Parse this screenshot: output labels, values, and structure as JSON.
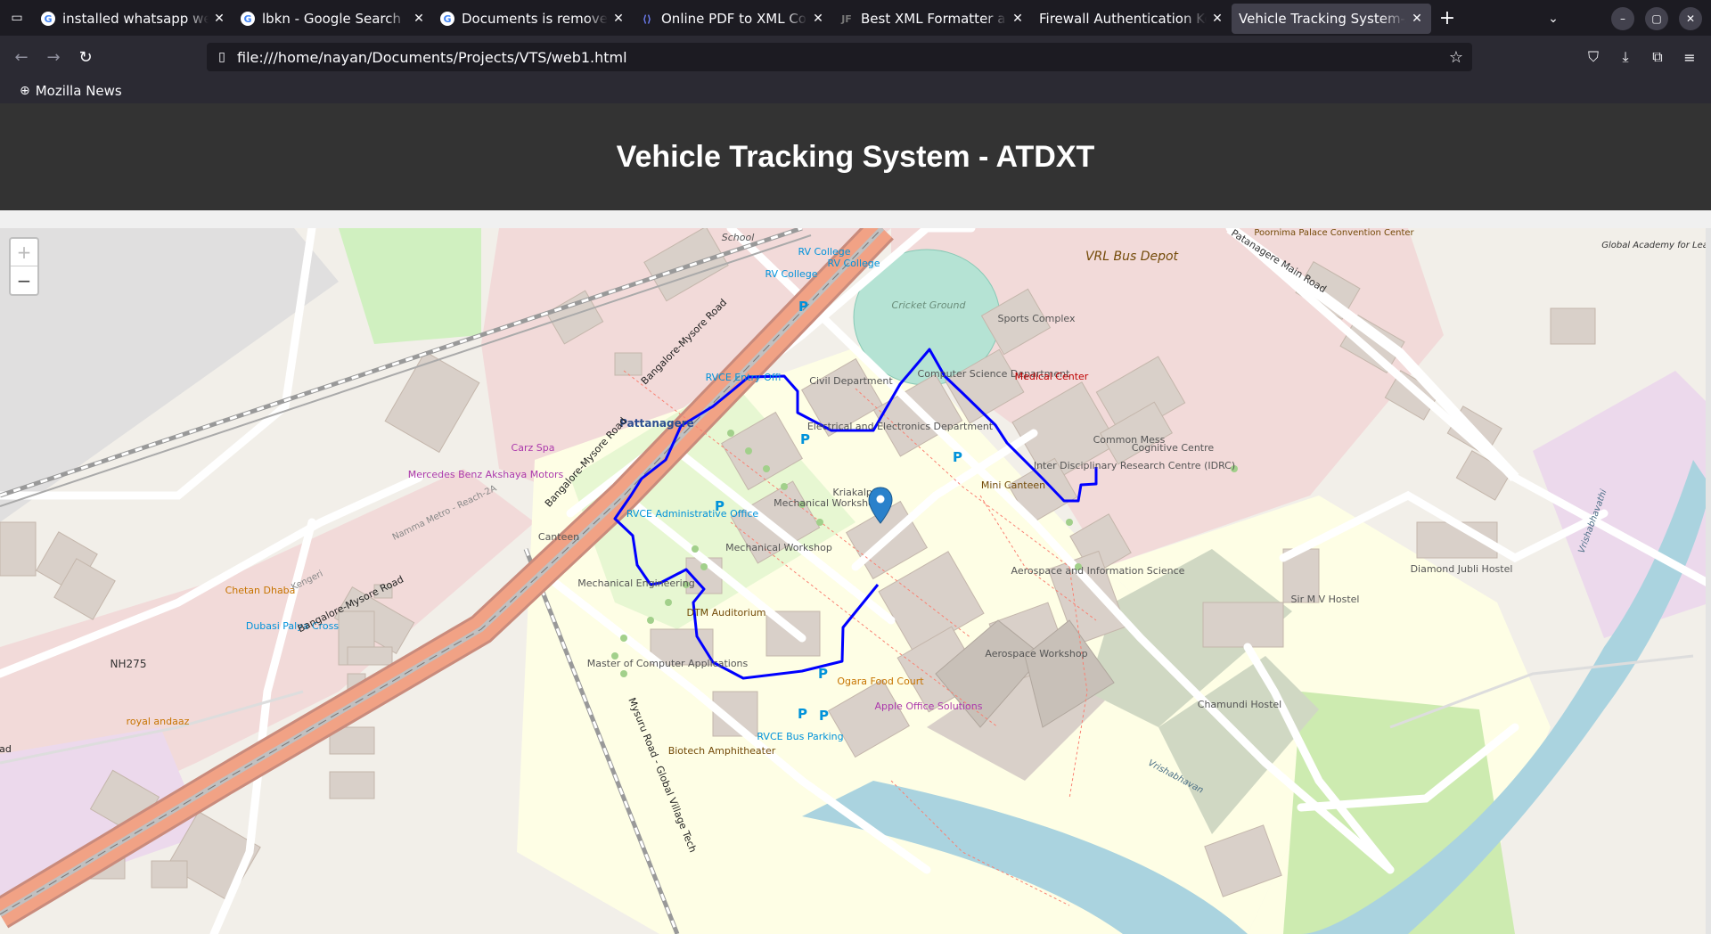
{
  "browser": {
    "tabs": [
      {
        "title": "installed whatsapp web",
        "favicon": "google-icon",
        "active": false
      },
      {
        "title": "lbkn - Google Search",
        "favicon": "google-icon",
        "active": false
      },
      {
        "title": "Documents is removed f",
        "favicon": "google-icon",
        "active": false
      },
      {
        "title": "Online PDF to XML Conv",
        "favicon": "convert-icon",
        "active": false
      },
      {
        "title": "Best XML Formatter and",
        "favicon": "jf-icon",
        "active": false
      },
      {
        "title": "Firewall Authentication Kee",
        "favicon": "none",
        "active": false
      },
      {
        "title": "Vehicle Tracking System-AT",
        "favicon": "none",
        "active": true
      }
    ],
    "url": "file:///home/nayan/Documents/Projects/VTS/web1.html",
    "bookmarks": [
      {
        "label": "Mozilla News"
      }
    ]
  },
  "page": {
    "title": "Vehicle Tracking System - ATDXT"
  },
  "map": {
    "zoom_in": "+",
    "zoom_out": "−",
    "route_color": "#0000ff",
    "marker_color": "#2a81cb",
    "labels": {
      "school": "School",
      "rv_college_1": "RV College",
      "rv_college_2": "RV College",
      "rv_college_3": "RV College",
      "cricket_ground": "Cricket Ground",
      "vrl_bus_depot": "VRL Bus Depot",
      "poornima_palace": "Poornima Palace Convention Center",
      "global_academy": "Global Academy for Learning",
      "patanagere_main_road": "Patanagere Main Road",
      "sports_complex": "Sports Complex",
      "computer_science": "Computer Science Department",
      "medical_center": "Medical Center",
      "civil_department": "Civil Department",
      "rvce_entry": "RVCE Entry Offi",
      "pattanagere": "Pattanagere",
      "electrical": "Electrical and Electronics Department",
      "common_mess": "Common Mess",
      "cognitive_centre": "Cognitive Centre",
      "idrc": "Inter Disciplinary Research Centre (IDRC)",
      "mini_canteen": "Mini Canteen",
      "kriakalpa": "Kriakalpa",
      "mech_workshop_1": "Mechanical Workshop",
      "mech_workshop_2": "Mechanical Workshop",
      "rvce_admin": "RVCE Administrative Office",
      "canteen": "Canteen",
      "mech_engineering": "Mechanical Engineering",
      "dtm_auditorium": "DTM Auditorium",
      "aerospace_info": "Aerospace and Information Science",
      "aerospace_workshop": "Aerospace Workshop",
      "mca": "Master of Computer Applications",
      "ogara": "Ogara Food Court",
      "apple_office": "Apple Office Solutions",
      "rvce_bus": "RVCE Bus Parking",
      "biotech": "Biotech Amphitheater",
      "sir_mv_hostel": "Sir M V Hostel",
      "diamond_hostel": "Diamond Jubli Hostel",
      "chamundi_hostel": "Chamundi Hostel",
      "carz_spa": "Carz Spa",
      "mercedes": "Mercedes Benz Akshaya Motors",
      "chetan_dhaba": "Chetan Dhaba",
      "dubasi": "Dubasi Palya Cross",
      "royal_andaaz": "royal andaaz",
      "nh275": "NH275",
      "bangalore_mysore_1": "Bangalore-Mysore Road",
      "bangalore_mysore_2": "Bangalore-Mysore Road",
      "bangalore_mysore_3": "Bangalore-Mysore Road",
      "namma_metro": "Namma Metro - Reach-2A",
      "kengeri": "Kengeri",
      "mysuru_road": "Mysuru Road - Global Village Tech",
      "vrishabhavathi_1": "Vrishabhavathi",
      "vrishabhavathi_2": "Vrishabhavan",
      "ad": "ad"
    }
  }
}
